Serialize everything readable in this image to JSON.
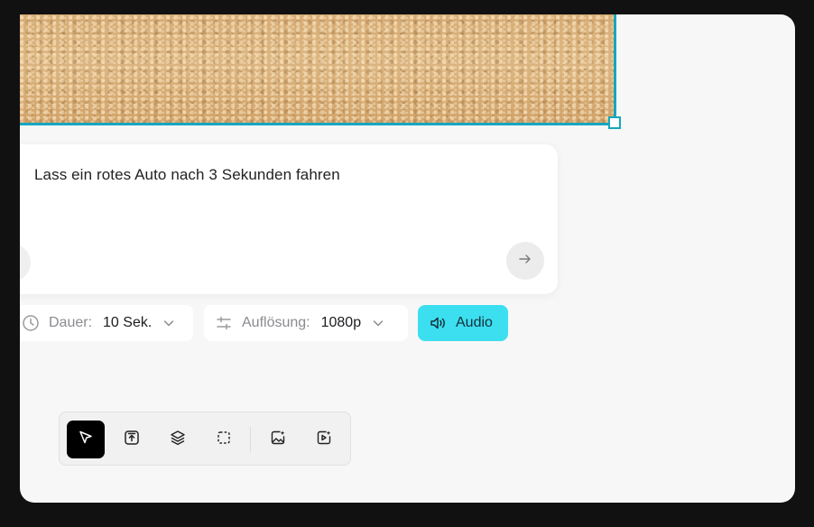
{
  "prompt": {
    "text": "Lass ein rotes Auto nach 3 Sekunden fahren",
    "send_icon": "arrow-right-icon"
  },
  "settings": {
    "duration": {
      "label": "Dauer:",
      "value": "10 Sek.",
      "icon": "clock-icon"
    },
    "resolution": {
      "label": "Auflösung:",
      "value": "1080p",
      "icon": "sliders-icon"
    },
    "audio": {
      "label": "Audio",
      "icon": "speaker-icon",
      "active_color": "#3cdff0"
    }
  },
  "toolbar": {
    "tools": [
      {
        "name": "select",
        "icon": "cursor-icon",
        "active": true
      },
      {
        "name": "upload",
        "icon": "upload-icon",
        "active": false
      },
      {
        "name": "layers",
        "icon": "layers-icon",
        "active": false
      },
      {
        "name": "frame",
        "icon": "dashed-frame-icon",
        "active": false
      },
      {
        "name": "image-generate",
        "icon": "image-sparkle-icon",
        "active": false
      },
      {
        "name": "video-generate",
        "icon": "video-sparkle-icon",
        "active": false
      }
    ]
  },
  "colors": {
    "selection": "#17a6bf",
    "canvas_bg": "#f7f7f8"
  }
}
